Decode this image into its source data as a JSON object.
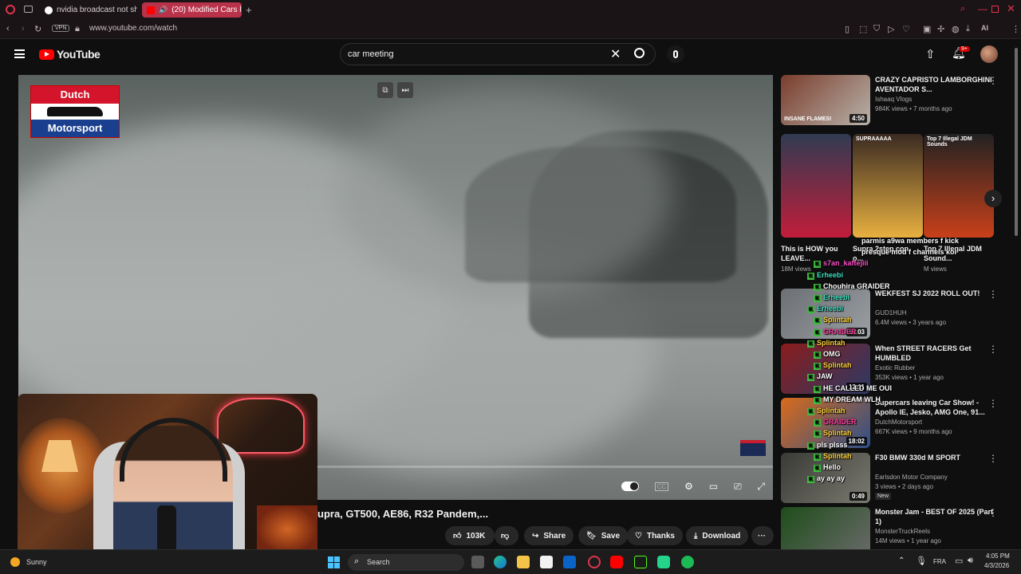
{
  "browser": {
    "tabs": [
      {
        "label": "nvidia broadcast not show",
        "active": false
      },
      {
        "label": "(20) Modified Cars lea",
        "active": true
      }
    ],
    "url": "www.youtube.com/watch",
    "vpn": "VPN",
    "ai_label": "AI"
  },
  "youtube": {
    "logo": "YouTube",
    "search_value": "car meeting",
    "notif_badge": "9+"
  },
  "video": {
    "watermark_top": "Dutch",
    "watermark_bottom": "Motorsport",
    "title": "upra, GT500, AE86, R32 Pandem,...",
    "likes": "103K",
    "actions": {
      "share": "Share",
      "save": "Save",
      "thanks": "Thanks",
      "download": "Download"
    }
  },
  "sidebar": {
    "items": [
      {
        "title": "CRAZY CAPRISTO LAMBORGHINI AVENTADOR S...",
        "channel": "Ishaaq Vlogs",
        "meta": "984K views • 7 months ago",
        "duration": "4:50",
        "thumb_caption": "INSANE FLAMES!",
        "colors": [
          "#7a3d2c",
          "#b8b2aa"
        ]
      },
      {
        "title": "WEKFEST SJ 2022 ROLL OUT!",
        "channel": "GUD1HUH",
        "meta": "6.4M views • 3 years ago",
        "duration": "10:03",
        "colors": [
          "#6c6f73",
          "#9ba0a4"
        ]
      },
      {
        "title": "When STREET RACERS Get HUMBLED",
        "channel": "Exotic Rubber",
        "meta": "353K views • 1 year ago",
        "duration": "12:11",
        "colors": [
          "#8a1c1c",
          "#2b3a66"
        ]
      },
      {
        "title": "Supercars leaving Car Show! - Apollo IE, Jesko, AMG One, 91...",
        "channel": "DutchMotorsport",
        "meta": "667K views • 9 months ago",
        "duration": "18:02",
        "colors": [
          "#d96b1a",
          "#2d4f8a"
        ]
      },
      {
        "title": "F30 BMW 330d M SPORT",
        "channel": "Earlsdon Motor Company",
        "meta": "3 views • 2 days ago",
        "badge": "New",
        "duration": "0:49",
        "colors": [
          "#3a3a36",
          "#7a7a70"
        ]
      },
      {
        "title": "Monster Jam - BEST OF 2025 (Part 1)",
        "channel": "MonsterTruckReels",
        "meta": "14M views • 1 year ago",
        "duration": "",
        "colors": [
          "#1e4d1a",
          "#6a6a6a"
        ]
      }
    ],
    "shorts": [
      {
        "title": "This is HOW you LEAVE...",
        "meta": "18M views",
        "colors": [
          "#2f3b52",
          "#c21d3a"
        ]
      },
      {
        "title": "Supra 2step cop o...",
        "meta": "",
        "caption": "SUPRAAAAA",
        "colors": [
          "#3a2a22",
          "#e8b040"
        ]
      },
      {
        "title": "Top 7 Illegal JDM Sound...",
        "meta": "M views",
        "caption": "Top 7 Illegal JDM Sounds",
        "colors": [
          "#222",
          "#c8401a"
        ]
      }
    ]
  },
  "chat": [
    {
      "text": "parmis a9wa members f kick",
      "color": "#ffffff"
    },
    {
      "text": "presque mod f channels koi",
      "color": "#ffffff"
    },
    {
      "text": "s7an_kaftejiii",
      "color": "#ff4fc8"
    },
    {
      "text": "Erheebi",
      "color": "#3fe0c0"
    },
    {
      "text": "Chouhira GRAIDER",
      "color": "#ffffff"
    },
    {
      "text": "Erheebi",
      "color": "#3fe0c0"
    },
    {
      "text": "Erheebi",
      "color": "#3fe0c0"
    },
    {
      "text": "Splintah",
      "color": "#ffd23f"
    },
    {
      "text": "GRAIDER",
      "color": "#ff3fa0"
    },
    {
      "text": "Splintah",
      "color": "#ffd23f"
    },
    {
      "text": "OMG",
      "color": "#ffffff"
    },
    {
      "text": "Splintah",
      "color": "#ffd23f"
    },
    {
      "text": "JAW",
      "color": "#ffffff"
    },
    {
      "text": "HE CALLED ME OUI",
      "color": "#ffffff"
    },
    {
      "text": "MY DREAM WLH",
      "color": "#ffffff"
    },
    {
      "text": "Splintah",
      "color": "#ffd23f"
    },
    {
      "text": "GRAIDER",
      "color": "#ff3fa0"
    },
    {
      "text": "Splintah",
      "color": "#ffd23f"
    },
    {
      "text": "pls plsss",
      "color": "#ffffff"
    },
    {
      "text": "Splintah",
      "color": "#ffd23f"
    },
    {
      "text": "Hello",
      "color": "#ffffff"
    },
    {
      "text": "ay ay ay",
      "color": "#ffffff"
    }
  ],
  "taskbar": {
    "weather": "Sunny",
    "search": "Search",
    "lang": "FRA",
    "time": "4:05 PM",
    "date": "4/3/2026"
  }
}
